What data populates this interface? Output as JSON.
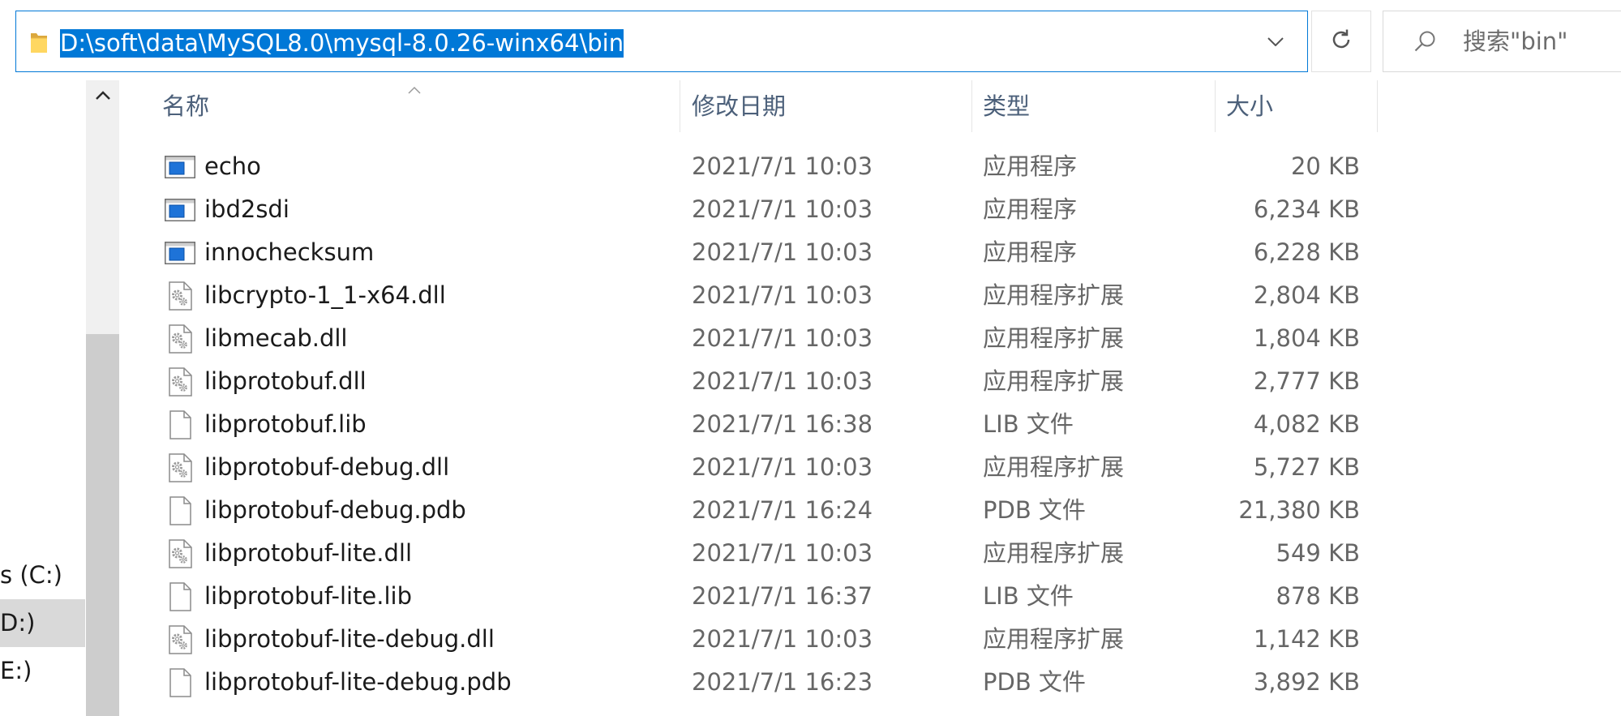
{
  "address_bar": {
    "path": "D:\\soft\\data\\MySQL8.0\\mysql-8.0.26-winx64\\bin",
    "path_selected": true,
    "location_icon": "folder-icon",
    "dropdown_icon": "chevron-down-icon"
  },
  "refresh": {
    "icon": "refresh-icon"
  },
  "search": {
    "placeholder": "搜索\"bin\"",
    "icon": "search-icon"
  },
  "nav": {
    "scroll_up_icon": "chevron-up-icon",
    "items": [
      {
        "label": "s (C:)",
        "selected": false
      },
      {
        "label": "D:)",
        "selected": true
      },
      {
        "label": "E:)",
        "selected": false
      }
    ]
  },
  "columns": [
    {
      "label": "名称",
      "sort": "ascending"
    },
    {
      "label": "修改日期"
    },
    {
      "label": "类型"
    },
    {
      "label": "大小"
    }
  ],
  "files": [
    {
      "name": "echo",
      "modified": "2021/7/1 10:03",
      "type": "应用程序",
      "size": "20 KB",
      "icon": "application-icon"
    },
    {
      "name": "ibd2sdi",
      "modified": "2021/7/1 10:03",
      "type": "应用程序",
      "size": "6,234 KB",
      "icon": "application-icon"
    },
    {
      "name": "innochecksum",
      "modified": "2021/7/1 10:03",
      "type": "应用程序",
      "size": "6,228 KB",
      "icon": "application-icon"
    },
    {
      "name": "libcrypto-1_1-x64.dll",
      "modified": "2021/7/1 10:03",
      "type": "应用程序扩展",
      "size": "2,804 KB",
      "icon": "dll-icon"
    },
    {
      "name": "libmecab.dll",
      "modified": "2021/7/1 10:03",
      "type": "应用程序扩展",
      "size": "1,804 KB",
      "icon": "dll-icon"
    },
    {
      "name": "libprotobuf.dll",
      "modified": "2021/7/1 10:03",
      "type": "应用程序扩展",
      "size": "2,777 KB",
      "icon": "dll-icon"
    },
    {
      "name": "libprotobuf.lib",
      "modified": "2021/7/1 16:38",
      "type": "LIB 文件",
      "size": "4,082 KB",
      "icon": "file-icon"
    },
    {
      "name": "libprotobuf-debug.dll",
      "modified": "2021/7/1 10:03",
      "type": "应用程序扩展",
      "size": "5,727 KB",
      "icon": "dll-icon"
    },
    {
      "name": "libprotobuf-debug.pdb",
      "modified": "2021/7/1 16:24",
      "type": "PDB 文件",
      "size": "21,380 KB",
      "icon": "file-icon"
    },
    {
      "name": "libprotobuf-lite.dll",
      "modified": "2021/7/1 10:03",
      "type": "应用程序扩展",
      "size": "549 KB",
      "icon": "dll-icon"
    },
    {
      "name": "libprotobuf-lite.lib",
      "modified": "2021/7/1 16:37",
      "type": "LIB 文件",
      "size": "878 KB",
      "icon": "file-icon"
    },
    {
      "name": "libprotobuf-lite-debug.dll",
      "modified": "2021/7/1 10:03",
      "type": "应用程序扩展",
      "size": "1,142 KB",
      "icon": "dll-icon"
    },
    {
      "name": "libprotobuf-lite-debug.pdb",
      "modified": "2021/7/1 16:23",
      "type": "PDB 文件",
      "size": "3,892 KB",
      "icon": "file-icon"
    }
  ],
  "colors": {
    "accent": "#0078d7",
    "selection_text": "#ffffff",
    "header_text": "#4c607a",
    "nav_selected_bg": "#d9d9d9",
    "secondary_text": "#666666"
  }
}
